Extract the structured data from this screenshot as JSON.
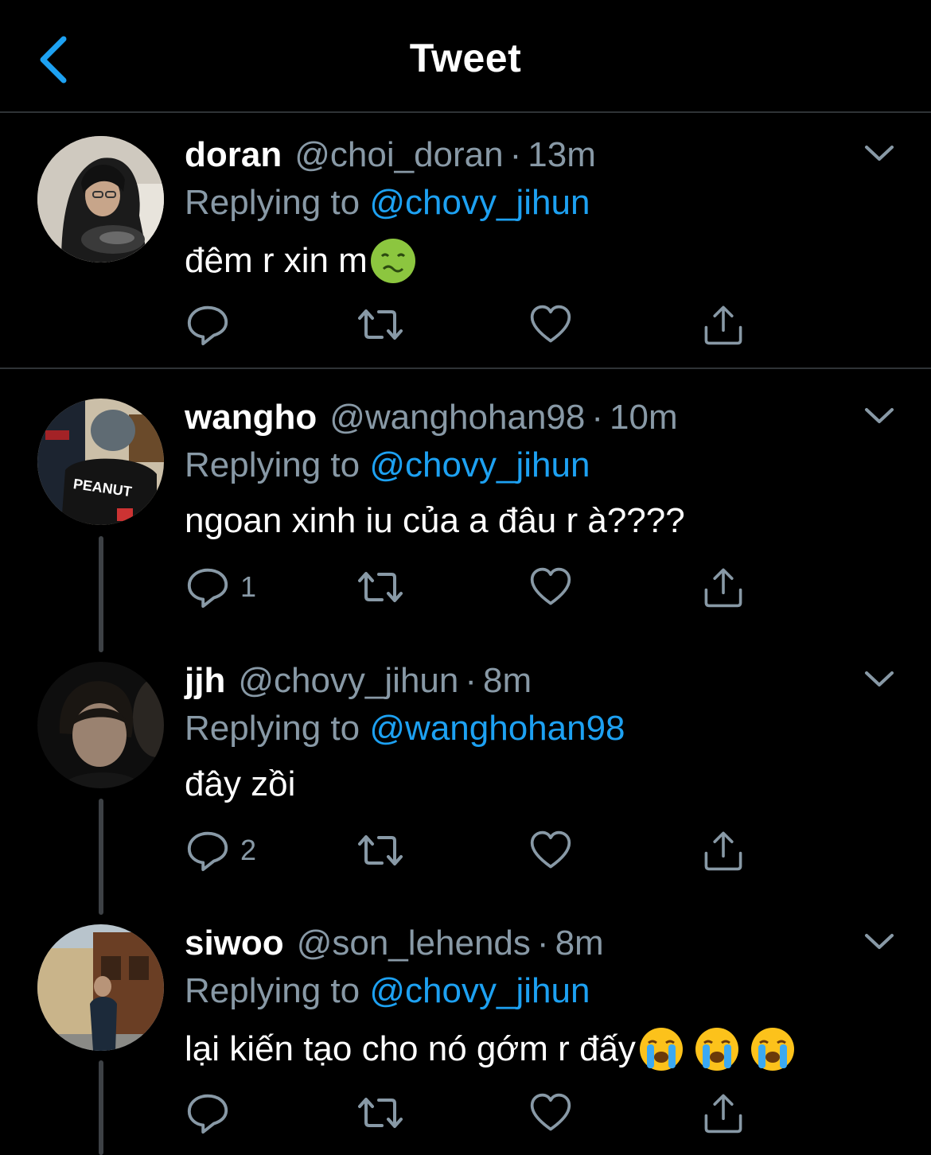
{
  "header": {
    "title": "Tweet",
    "back_icon": "chevron-left-icon",
    "accent": "#1da1f2"
  },
  "colors": {
    "background": "#000000",
    "muted": "#8899a6",
    "mention": "#1da1f2",
    "divider": "#2f3336"
  },
  "tweets": [
    {
      "name": "doran",
      "handle": "@choi_doran",
      "separator": "·",
      "time": "13m",
      "replying_prefix": "Replying to",
      "replying_to": "@chovy_jihun",
      "text": "đêm r xin m",
      "emojis": [
        "nauseated-face-emoji"
      ],
      "reply_count": "",
      "avatar": "avatar-doran"
    },
    {
      "name": "wangho",
      "handle": "@wanghohan98",
      "separator": "·",
      "time": "10m",
      "replying_prefix": "Replying to",
      "replying_to": "@chovy_jihun",
      "text": "ngoan xinh iu của a đâu r à????",
      "emojis": [],
      "reply_count": "1",
      "avatar": "avatar-wangho",
      "avatar_jersey_text": "PEANUT"
    },
    {
      "name": "jjh",
      "handle": "@chovy_jihun",
      "separator": "·",
      "time": "8m",
      "replying_prefix": "Replying to",
      "replying_to": "@wanghohan98",
      "text": "đây zồi",
      "emojis": [],
      "reply_count": "2",
      "avatar": "avatar-jjh"
    },
    {
      "name": "siwoo",
      "handle": "@son_lehends",
      "separator": "·",
      "time": "8m",
      "replying_prefix": "Replying to",
      "replying_to": "@chovy_jihun",
      "text": "lại kiến tạo cho nó gớm r đấy",
      "emojis": [
        "loudly-crying-face-emoji",
        "loudly-crying-face-emoji",
        "loudly-crying-face-emoji"
      ],
      "reply_count": "",
      "avatar": "avatar-siwoo"
    }
  ],
  "action_icons": [
    "reply-icon",
    "retweet-icon",
    "like-icon",
    "share-icon"
  ]
}
